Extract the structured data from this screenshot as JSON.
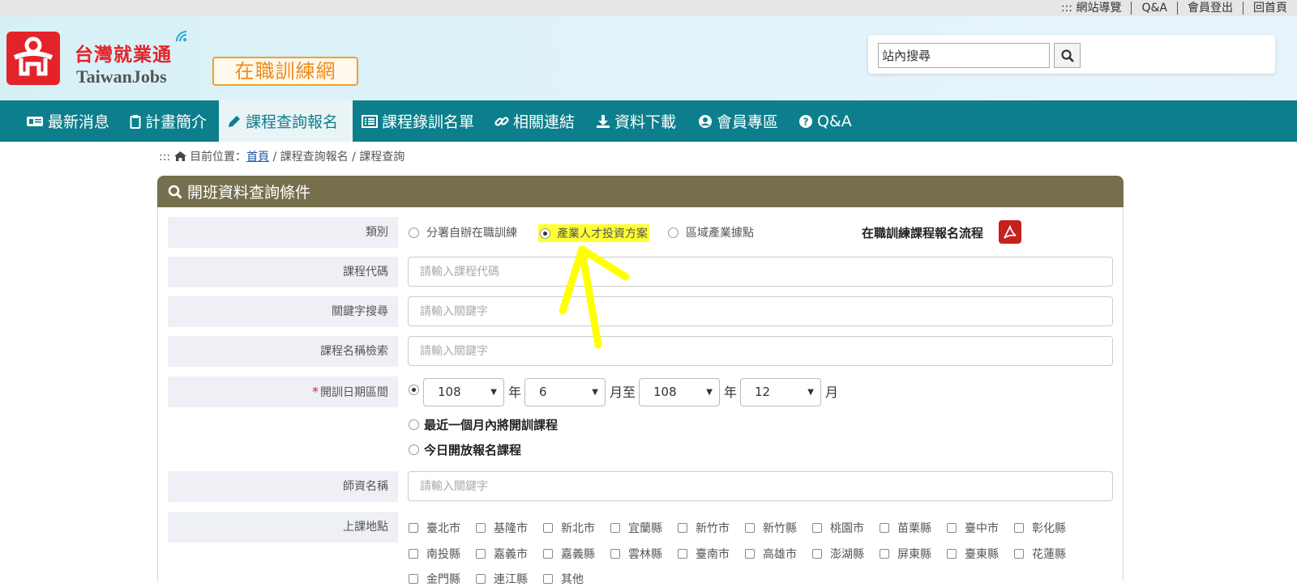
{
  "topbar": {
    "sitemap": "::: 網站導覽",
    "qa": "Q&A",
    "logout": "會員登出",
    "home": "回首頁"
  },
  "header": {
    "logo_title": "台灣就業通",
    "logo_sub": "TaiwanJobs",
    "badge": "在職訓練網",
    "search_value": "站內搜尋",
    "search_icon": "search-icon"
  },
  "nav": {
    "items": [
      {
        "label": "最新消息",
        "icon": "news-icon"
      },
      {
        "label": "計畫簡介",
        "icon": "clipboard-icon"
      },
      {
        "label": "課程查詢報名",
        "icon": "pencil-icon"
      },
      {
        "label": "課程錄訓名單",
        "icon": "list-icon"
      },
      {
        "label": "相關連結",
        "icon": "link-icon"
      },
      {
        "label": "資料下載",
        "icon": "download-icon"
      },
      {
        "label": "會員專區",
        "icon": "user-icon"
      },
      {
        "label": "Q&A",
        "icon": "question-icon"
      }
    ],
    "active_index": 2
  },
  "breadcrumb": {
    "prefix": "::: ",
    "label": "目前位置：",
    "home": "首頁",
    "rest": " / 課程查詢報名 / 課程查詢"
  },
  "panel": {
    "title": "開班資料查詢條件",
    "category": {
      "label": "類別",
      "options": [
        "分署自辦在職訓練",
        "產業人才投資方案",
        "區域產業據點"
      ],
      "selected_index": 1
    },
    "pdf_link": "在職訓練課程報名流程",
    "course_code": {
      "label": "課程代碼",
      "placeholder": "請輸入課程代碼"
    },
    "keyword": {
      "label": "關鍵字搜尋",
      "placeholder": "請輸入關鍵字"
    },
    "course_name": {
      "label": "課程名稱檢索",
      "placeholder": "請輸入關鍵字"
    },
    "date_range": {
      "required_mark": "*",
      "label": "開訓日期區間",
      "from_year": "108",
      "year_unit": "年",
      "from_month": "6",
      "month_to_unit": "月至",
      "to_year": "108",
      "year_unit2": "年",
      "to_month": "12",
      "month_unit": "月",
      "opt_recent": "最近一個月內將開訓課程",
      "opt_today": "今日開放報名課程"
    },
    "teacher": {
      "label": "師資名稱",
      "placeholder": "請輸入關鍵字"
    },
    "location": {
      "label": "上課地點",
      "row1": [
        "臺北市",
        "基隆市",
        "新北市",
        "宜蘭縣",
        "新竹市",
        "新竹縣",
        "桃園市",
        "苗栗縣",
        "臺中市",
        "彰化縣"
      ],
      "row2": [
        "南投縣",
        "嘉義市",
        "嘉義縣",
        "雲林縣",
        "臺南市",
        "高雄市",
        "澎湖縣",
        "屏東縣",
        "臺東縣",
        "花蓮縣"
      ],
      "row3": [
        "金門縣",
        "連江縣",
        "其他"
      ]
    }
  },
  "colors": {
    "nav": "#0d7f8c",
    "panel_head": "#756f4d",
    "logo_red": "#e3232a",
    "badge_orange": "#ef8b1a",
    "highlight": "#ffff33",
    "annotation_arrow": "#ffff00"
  }
}
